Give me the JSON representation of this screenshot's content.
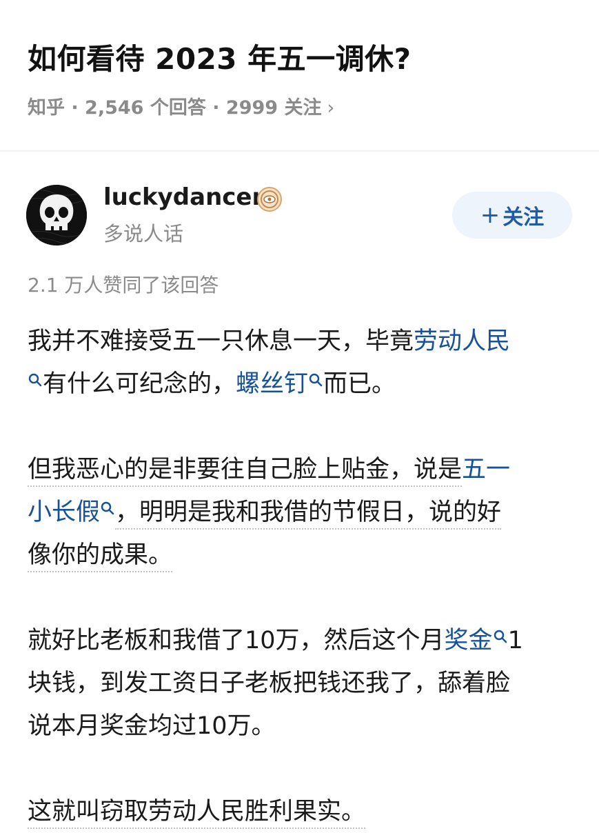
{
  "question": {
    "title": "如何看待 2023 年五一调休?",
    "meta": "知乎 · 2,546 个回答 · 2999 关注",
    "chevron": "›"
  },
  "author": {
    "name": "luckydancer",
    "bio": "多说人话",
    "follow_plus": "+",
    "follow_label": "关注",
    "badge_icon": "badge-icon",
    "avatar_icon": "skull-icon"
  },
  "answer": {
    "upvotes": "2.1 万人赞同了该回答",
    "p1": {
      "l1a": "我并不难接受五一只休息一天，毕竟",
      "l1kw": "劳动人民",
      "l2a": "有什么可纪念的，",
      "l2kw": "螺丝钉",
      "l2b": "而已。"
    },
    "p2": {
      "l1a": "但我恶心的是非要往自己脸上贴金，说是",
      "l1kw": "五一",
      "l2kw": "小长假",
      "l2b": "，明明是我和我借的节假日，说的好",
      "l3": "像你的成果。"
    },
    "p3": {
      "l1a": "就好比老板和我借了10万，然后这个月",
      "l1kw": "奖金",
      "l1b": "1",
      "l2": "块钱，到发工资日子老板把钱还我了，舔着脸",
      "l3": "说本月奖金均过10万。"
    },
    "p4": {
      "l1": "这就叫窃取劳动人民胜利果实。"
    }
  },
  "colors": {
    "link": "#175199",
    "meta_gray": "#8a8a8a",
    "follow_bg": "#eef4fb",
    "follow_text": "#1e5aa8"
  }
}
